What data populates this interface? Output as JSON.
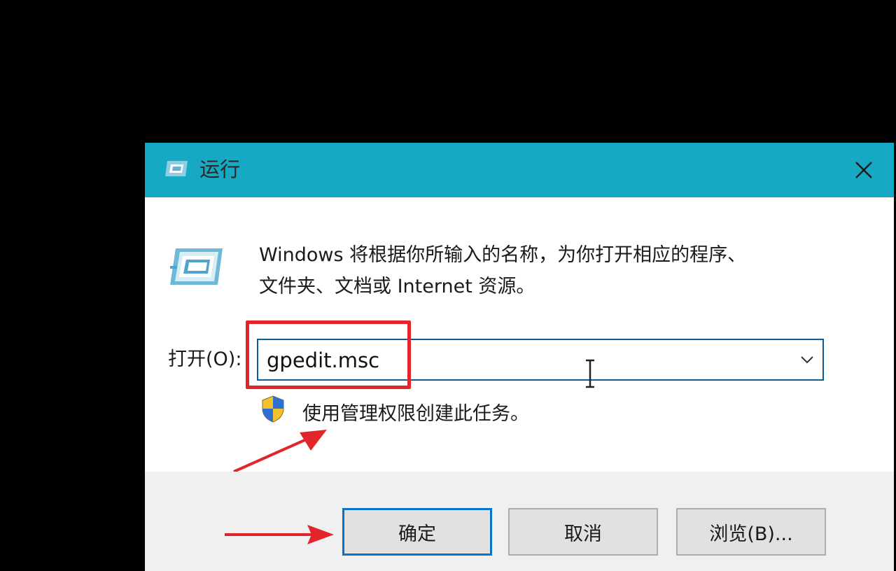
{
  "window": {
    "title": "运行",
    "close_icon": "close-icon"
  },
  "body": {
    "description_line1": "Windows 将根据你所输入的名称，为你打开相应的程序、",
    "description_line2": "文件夹、文档或 Internet 资源。",
    "open_label": "打开(O):",
    "open_value": "gpedit.msc",
    "admin_note": "使用管理权限创建此任务。"
  },
  "buttons": {
    "ok": "确定",
    "cancel": "取消",
    "browse": "浏览(B)..."
  },
  "colors": {
    "titlebar": "#17a9c3",
    "highlight": "#e1252b",
    "focus": "#0a72c8"
  },
  "icons": [
    "run-app-icon",
    "run-dialog-icon",
    "shield-icon",
    "chevron-down-icon",
    "text-cursor-icon",
    "red-arrow-icon"
  ]
}
